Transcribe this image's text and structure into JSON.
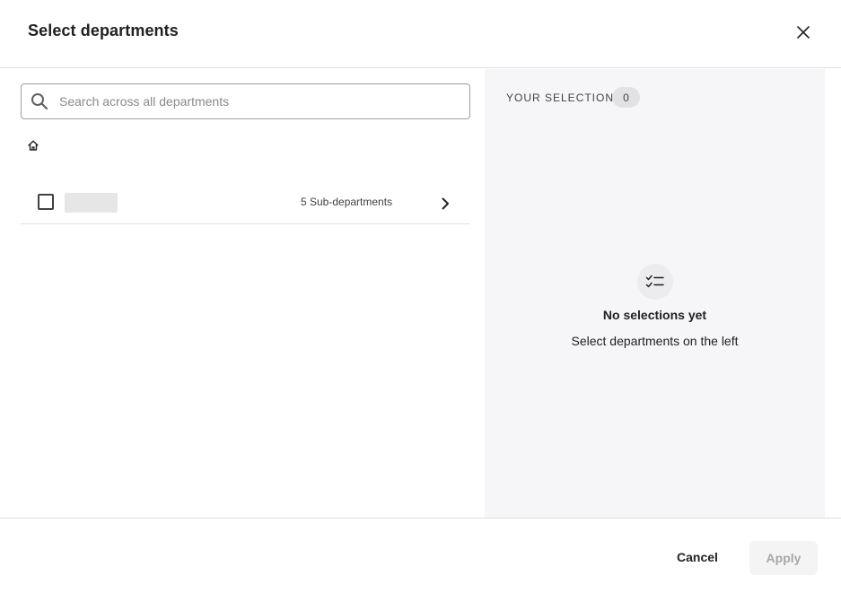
{
  "dialog": {
    "title": "Select departments"
  },
  "search": {
    "placeholder": "Search across all departments",
    "value": ""
  },
  "breadcrumb": {
    "home_icon": "home-icon"
  },
  "departments": [
    {
      "name": "",
      "checked": false,
      "sub_count_label": "5 Sub-departments"
    }
  ],
  "selection": {
    "label": "YOUR SELECTION",
    "count": "0",
    "empty_title": "No selections yet",
    "empty_subtitle": "Select departments on the left"
  },
  "footer": {
    "cancel_label": "Cancel",
    "apply_label": "Apply"
  },
  "colors": {
    "right_pane_bg": "#f6f6f8",
    "divider": "#e0e0e0",
    "disabled_text": "#a8a8a8"
  }
}
